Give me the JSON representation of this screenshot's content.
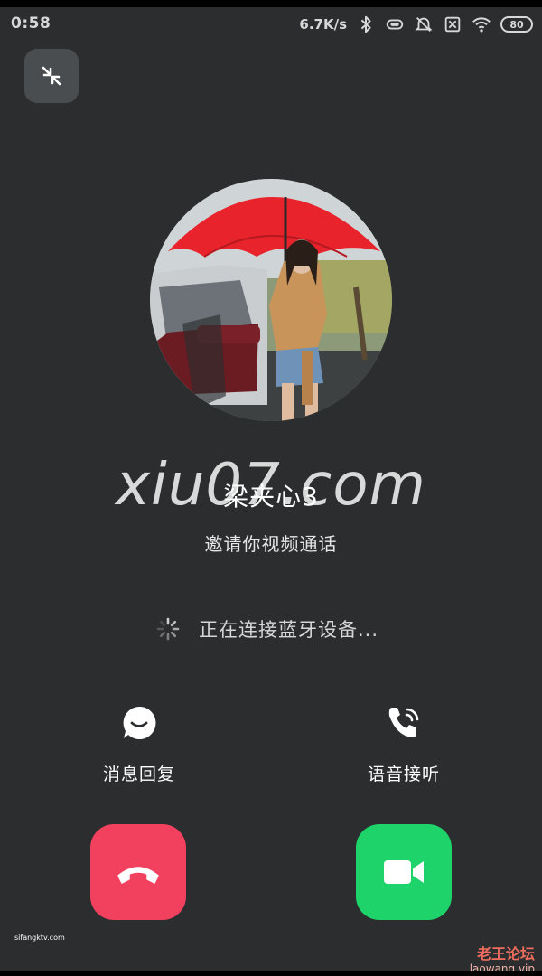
{
  "status_bar": {
    "time": "0:58",
    "network_speed": "6.7K/s",
    "battery": "80",
    "icons": [
      "bluetooth-icon",
      "vibrate-icon",
      "mute-icon",
      "no-sim-icon",
      "wifi-icon",
      "battery-icon"
    ]
  },
  "caller": {
    "name": "梁夹心3",
    "invite": "邀请你视频通话"
  },
  "connection": {
    "status": "正在连接蓝牙设备..."
  },
  "actions": {
    "message_reply": "消息回复",
    "voice_answer": "语音接听"
  },
  "colors": {
    "background": "#2b2d2e",
    "decline": "#f2405f",
    "accept": "#1ed36a"
  },
  "watermarks": {
    "main": "xiu07.com",
    "small": "sifangktv.com",
    "forum_name": "老王论坛",
    "forum_url": "laowang.vip"
  }
}
